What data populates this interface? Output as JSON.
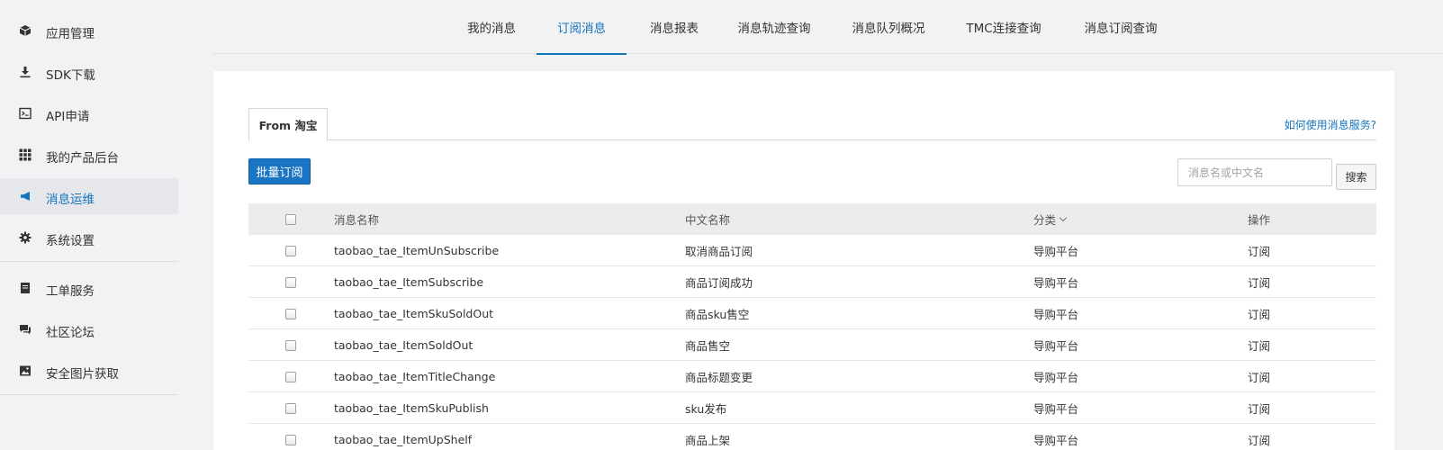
{
  "sidebar": {
    "items": [
      {
        "label": "应用管理",
        "icon": "cube-icon"
      },
      {
        "label": "SDK下载",
        "icon": "download-icon"
      },
      {
        "label": "API申请",
        "icon": "terminal-icon"
      },
      {
        "label": "我的产品后台",
        "icon": "grid-icon"
      },
      {
        "label": "消息运维",
        "icon": "megaphone-icon"
      },
      {
        "label": "系统设置",
        "icon": "gear-icon"
      },
      {
        "label": "工单服务",
        "icon": "ticket-icon"
      },
      {
        "label": "社区论坛",
        "icon": "chat-icon"
      },
      {
        "label": "安全图片获取",
        "icon": "image-icon"
      }
    ],
    "active_index": 4
  },
  "top_tabs": {
    "items": [
      "我的消息",
      "订阅消息",
      "消息报表",
      "消息轨迹查询",
      "消息队列概况",
      "TMC连接查询",
      "消息订阅查询"
    ],
    "active_index": 1
  },
  "panel": {
    "subtab_label": "From 淘宝",
    "help_link": "如何使用消息服务?",
    "batch_button": "批量订阅",
    "search": {
      "placeholder": "消息名或中文名",
      "value": "",
      "button_label": "搜索"
    }
  },
  "table": {
    "headers": {
      "name": "消息名称",
      "cn_name": "中文名称",
      "category": "分类",
      "action": "操作"
    },
    "rows": [
      {
        "name": "taobao_tae_ItemUnSubscribe",
        "cn_name": "取消商品订阅",
        "category": "导购平台",
        "action": "订阅"
      },
      {
        "name": "taobao_tae_ItemSubscribe",
        "cn_name": "商品订阅成功",
        "category": "导购平台",
        "action": "订阅"
      },
      {
        "name": "taobao_tae_ItemSkuSoldOut",
        "cn_name": "商品sku售空",
        "category": "导购平台",
        "action": "订阅"
      },
      {
        "name": "taobao_tae_ItemSoldOut",
        "cn_name": "商品售空",
        "category": "导购平台",
        "action": "订阅"
      },
      {
        "name": "taobao_tae_ItemTitleChange",
        "cn_name": "商品标题变更",
        "category": "导购平台",
        "action": "订阅"
      },
      {
        "name": "taobao_tae_ItemSkuPublish",
        "cn_name": "sku发布",
        "category": "导购平台",
        "action": "订阅"
      },
      {
        "name": "taobao_tae_ItemUpShelf",
        "cn_name": "商品上架",
        "category": "导购平台",
        "action": "订阅"
      }
    ]
  },
  "colors": {
    "accent": "#1574bc",
    "primary_button": "#1a75c4",
    "link": "#1f5f9e",
    "background": "#f1f2f4"
  }
}
